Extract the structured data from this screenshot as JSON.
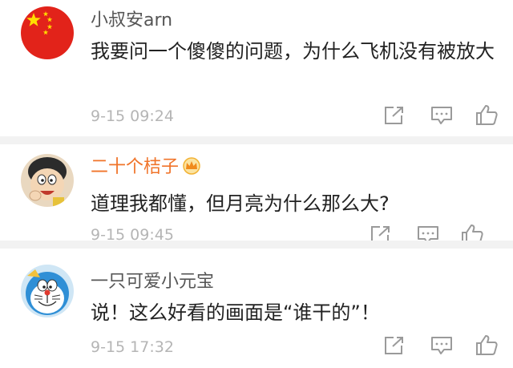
{
  "comments": [
    {
      "username": "小叔安arn",
      "text": "我要问一个傻傻的问题，为什么飞机没有被放大",
      "time": "9-15 09:24",
      "avatar": "china-flag-icon"
    },
    {
      "username": "二十个桔子",
      "text": "道理我都懂，但月亮为什么那么大?",
      "time": "9-15 09:45",
      "avatar": "nobita-cartoon-avatar",
      "badge": "vip-crown-icon"
    },
    {
      "username": "一只可爱小元宝",
      "text": "说！这么好看的画面是“谁干的”！",
      "time": "9-15 17:32",
      "avatar": "doraemon-cartoon-avatar"
    }
  ],
  "actions": [
    "share-icon",
    "comment-icon",
    "like-icon"
  ],
  "colors": {
    "username_default": "#555555",
    "username_vip": "#f0742a",
    "text": "#222222",
    "time": "#b5b5b5",
    "icon": "#9a9a9a",
    "separator": "#f2f2f2"
  }
}
